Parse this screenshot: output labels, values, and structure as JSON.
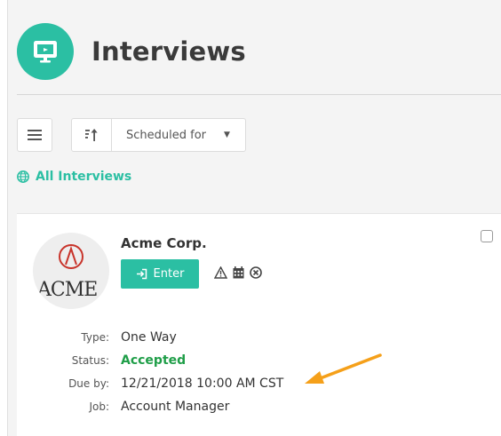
{
  "header": {
    "title": "Interviews",
    "icon": "monitor-icon"
  },
  "toolbar": {
    "list_icon": "list-icon",
    "sort_icon": "sort-icon",
    "sort_select": "Scheduled for",
    "caret_icon": "caret-down-icon"
  },
  "filter": {
    "label": "All Interviews",
    "icon": "globe-icon"
  },
  "card": {
    "company": "Acme Corp.",
    "logo_text": "ACME",
    "enter_label": "Enter",
    "icons": [
      "warning-icon",
      "calendar-icon",
      "cancel-icon"
    ],
    "fields": [
      {
        "label": "Type:",
        "value": "One Way"
      },
      {
        "label": "Status:",
        "value": "Accepted"
      },
      {
        "label": "Due by:",
        "value": "12/21/2018 10:00 AM CST"
      },
      {
        "label": "Job:",
        "value": "Account Manager"
      }
    ]
  },
  "colors": {
    "accent": "#2bbfa3",
    "accepted": "#1f9e48",
    "arrow": "#f5a01a",
    "logo_red": "#c8342b"
  }
}
